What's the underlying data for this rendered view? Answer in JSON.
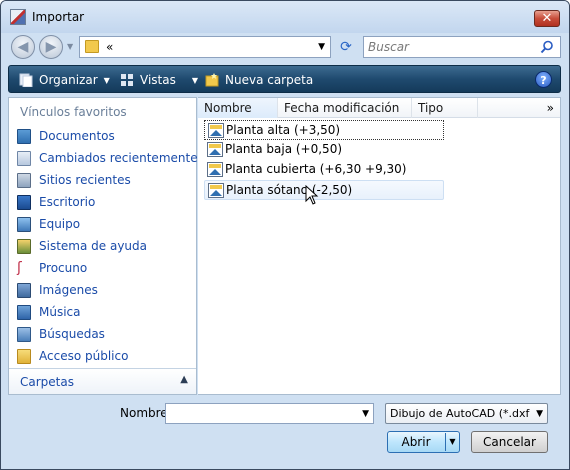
{
  "window": {
    "title": "Importar",
    "close_label": "✕"
  },
  "nav": {
    "back_label": "◀",
    "forward_label": "▶",
    "address_text": "«",
    "refresh_label": "⟳",
    "search_placeholder": "Buscar"
  },
  "toolbar": {
    "organize_label": "Organizar",
    "views_label": "Vistas",
    "new_folder_label": "Nueva carpeta",
    "help_label": "?"
  },
  "sidebar": {
    "favorites_title": "Vínculos favoritos",
    "items": [
      {
        "label": "Documentos",
        "icon": "documents-icon"
      },
      {
        "label": "Cambiados recientemente",
        "icon": "recently-changed-icon"
      },
      {
        "label": "Sitios recientes",
        "icon": "recent-places-icon"
      },
      {
        "label": "Escritorio",
        "icon": "desktop-icon"
      },
      {
        "label": "Equipo",
        "icon": "computer-icon"
      },
      {
        "label": "Sistema de ayuda",
        "icon": "help-system-icon"
      },
      {
        "label": "Procuno",
        "icon": "procuno-icon"
      },
      {
        "label": "Imágenes",
        "icon": "pictures-icon"
      },
      {
        "label": "Música",
        "icon": "music-icon"
      },
      {
        "label": "Búsquedas",
        "icon": "searches-icon"
      },
      {
        "label": "Acceso público",
        "icon": "public-folder-icon"
      }
    ],
    "folders_label": "Carpetas"
  },
  "columns": {
    "name": "Nombre",
    "modified": "Fecha modificación",
    "type": "Tipo",
    "more": "»"
  },
  "files": [
    {
      "label": "Planta alta (+3,50)"
    },
    {
      "label": "Planta baja (+0,50)"
    },
    {
      "label": "Planta cubierta (+6,30 +9,30)"
    },
    {
      "label": "Planta sótano (-2,50)"
    }
  ],
  "bottom": {
    "name_label": "Nombre:",
    "name_value": "",
    "file_type": "Dibujo de AutoCAD (*.dxf;*.dw",
    "open_label": "Abrir",
    "cancel_label": "Cancelar"
  },
  "colors": {
    "toolbar": "#1f4a6f",
    "link": "#1a4ba8",
    "window_frame": "#cfe0f2"
  }
}
